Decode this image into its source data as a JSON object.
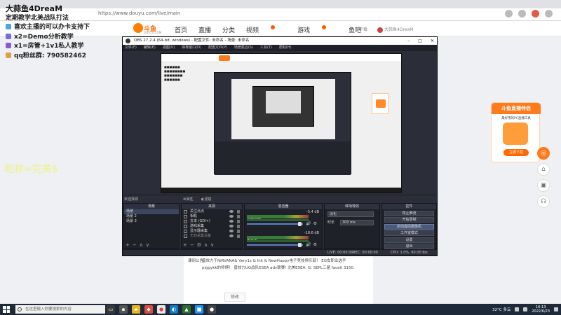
{
  "browser": {
    "url": "https://www.douyu.com/live/main"
  },
  "overlay": {
    "title": "大蒜鱼4DreaM",
    "lines": [
      "定期教学北美战队打法",
      "喜欢主播的可以办卡支持下",
      "x2=Demo分析教学",
      "x1=房管+1v1私人教学",
      "qq粉丝群: 790582462"
    ],
    "yellow_text": "昵称=完美$"
  },
  "site": {
    "logo_text": "斗鱼",
    "logo_sub": "DOUYU.COM",
    "nav": [
      "首页",
      "直播",
      "分类",
      "视频",
      "游戏",
      "鱼吧"
    ],
    "header_right": [
      "下载",
      "大蒜鱼4DreaM"
    ]
  },
  "chat": {
    "label": "课间公告:",
    "text": "曾效力于NiRVANA& Very1z & Ink & NewHappy电子竞技俱乐部！ EG女职业选手piggykk的师傅！ 曾效力UG战队ESEA adv联赛! 北美ESEA: G: SEPL三届 faceit 3150.",
    "button": "修改"
  },
  "promo": {
    "title": "斗鱼直播伴侣",
    "subtitle": "最好用的PC直播工具",
    "button": "立即下载"
  },
  "obs": {
    "title": "OBS 27.2.4 (64-bit, windows) - 配置文件: 未命名 - 场景: 未命名",
    "menu": [
      "文件(F)",
      "编辑(E)",
      "视图(V)",
      "停靠窗口(D)",
      "配置文件(P)",
      "场景集合(S)",
      "工具(T)",
      "帮助(H)"
    ],
    "hotbar_label": "未选择源",
    "hotbar_items": [
      "属性",
      "滤镜"
    ],
    "docks": {
      "scenes": {
        "title": "场景",
        "items": [
          "场景",
          "场景 2",
          "场景 3"
        ]
      },
      "sources": {
        "title": "来源",
        "items": [
          "关注点点",
          "相机",
          "文本 (GDI+)",
          "游戏采集",
          "显示器采集",
          "无效采集设备"
        ]
      },
      "mixer": {
        "title": "混音器",
        "channels": [
          {
            "name": "桌面音频",
            "db": "-5.4 dB"
          },
          {
            "name": "麦克风",
            "db": "-18.6 dB"
          }
        ]
      },
      "transitions": {
        "title": "转场特效",
        "type": "淡化",
        "duration_label": "时长",
        "duration": "300 ms"
      },
      "controls": {
        "title": "控件",
        "buttons": [
          "停止推流",
          "开始录制",
          "启动虚拟摄像机",
          "工作室模式",
          "设置",
          "退出"
        ]
      }
    },
    "status": {
      "live": "LIVE: 00:00:00",
      "rec": "REC: 00:00:00",
      "cpu": "CPU: 1.0%, 60.00 fps"
    }
  },
  "taskbar": {
    "search_placeholder": "在这里输入你要搜索的内容",
    "weather": "32°C 多云",
    "time": "16:13",
    "date": "2022/6/23"
  },
  "colors": {
    "douyu_orange": "#ff7a1a",
    "obs_bg": "#2b2e38",
    "taskbar": "#1e2a3a"
  }
}
